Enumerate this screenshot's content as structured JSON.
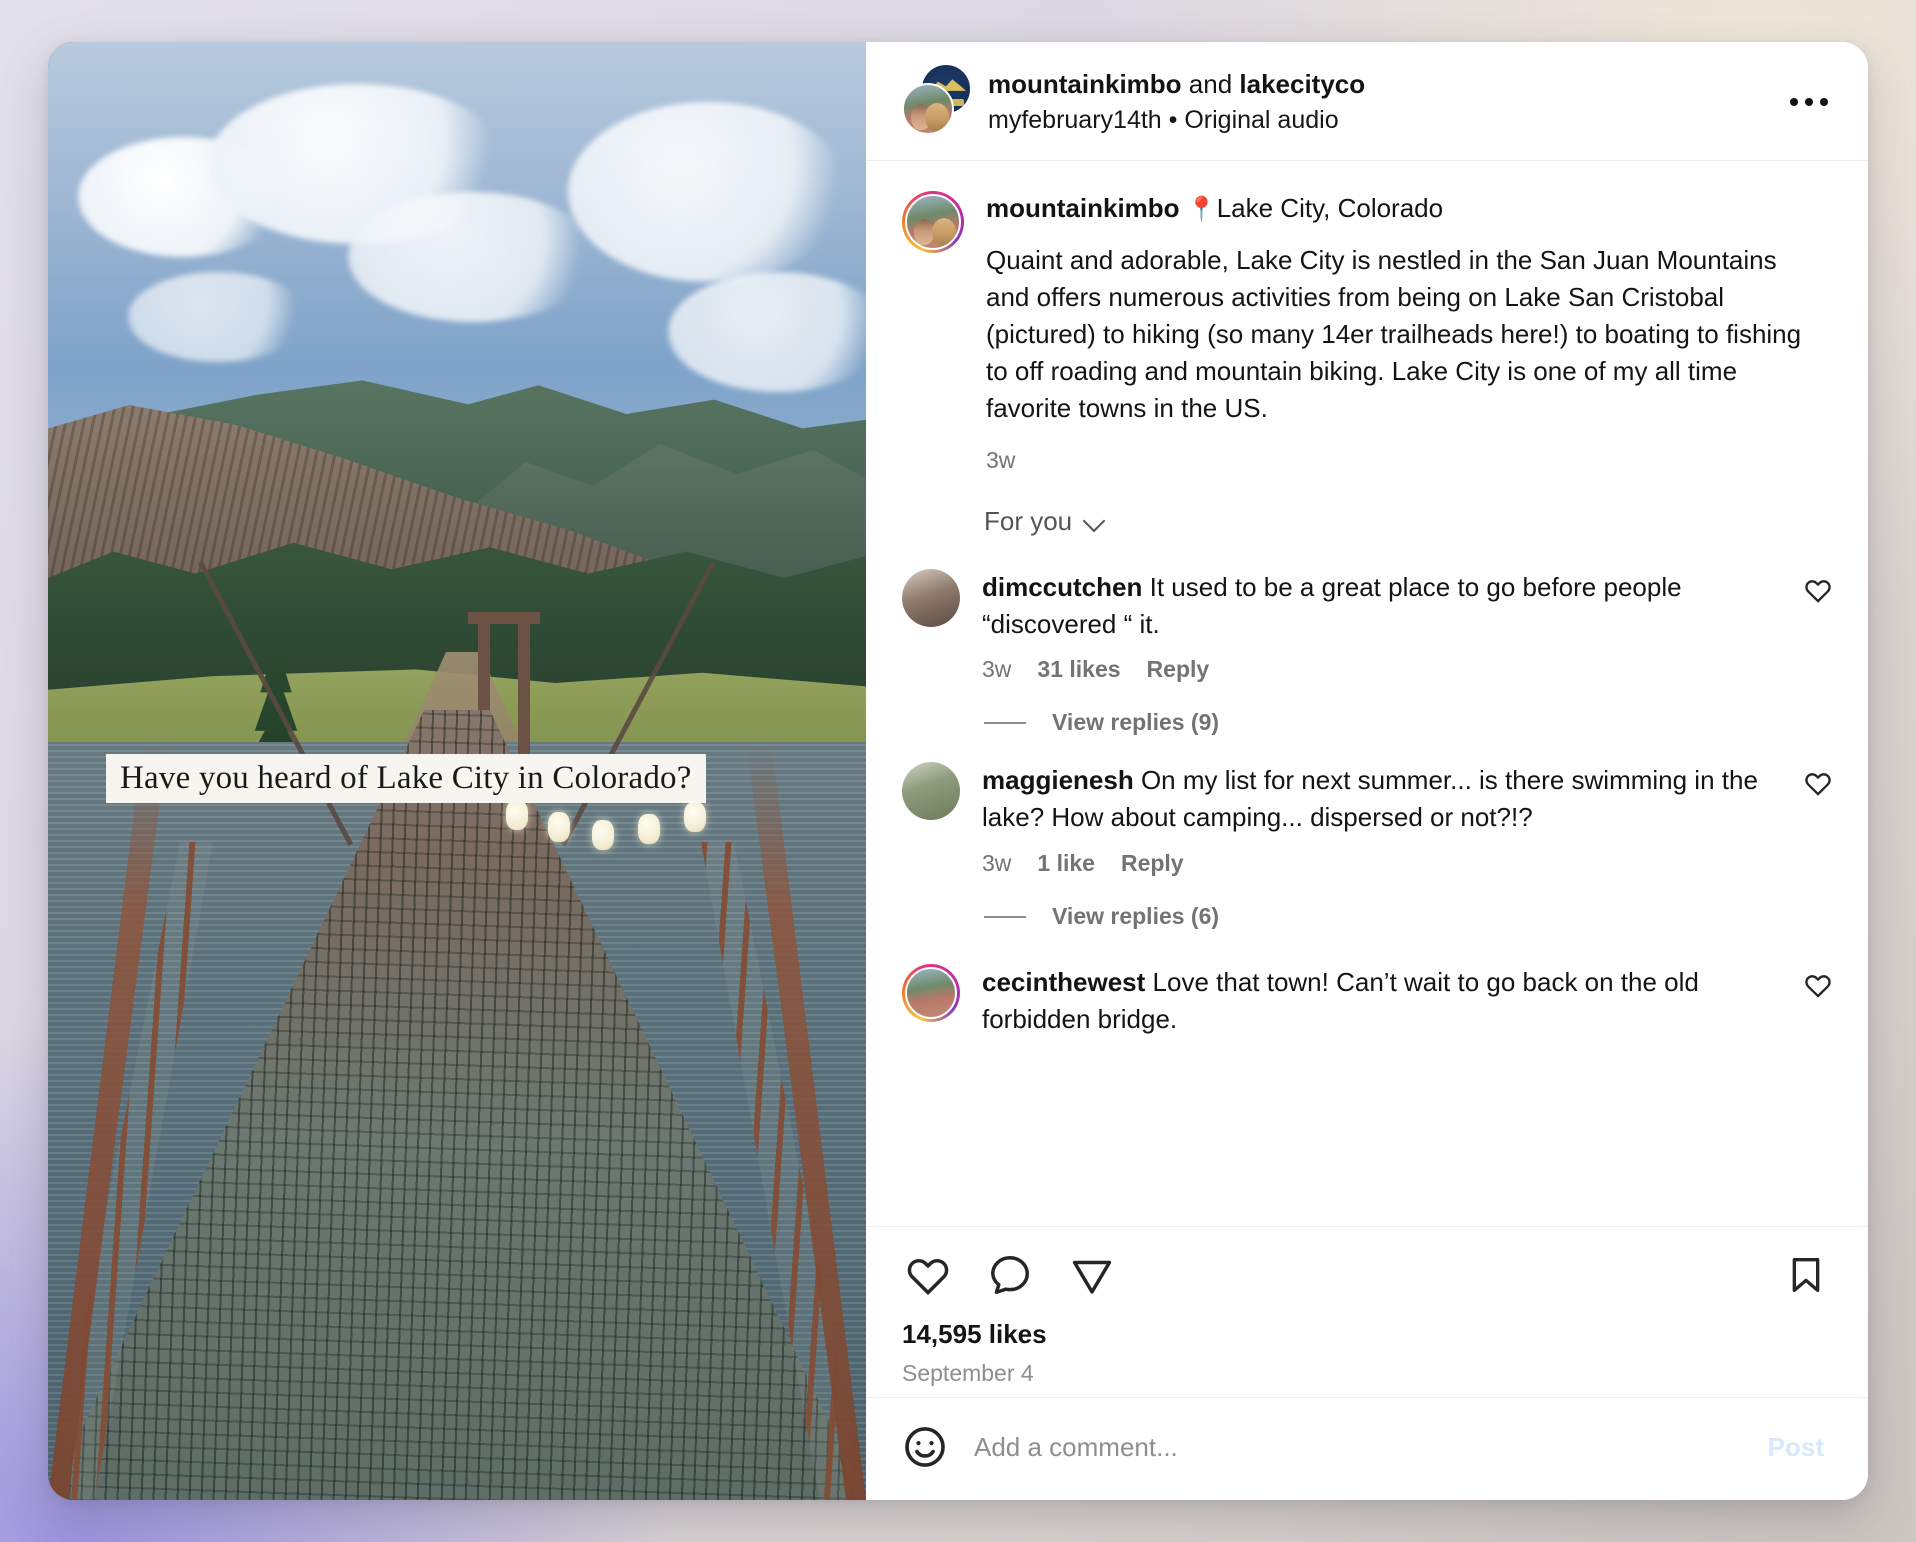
{
  "header": {
    "account_primary": "mountainkimbo",
    "conjunction": " and ",
    "account_secondary": "lakecityco",
    "audio_line": "myfebruary14th • Original audio",
    "more_menu_label": "More options"
  },
  "caption": {
    "username": "mountainkimbo",
    "location_pin": "📍",
    "location": "Lake City, Colorado",
    "text": "Quaint and adorable, Lake City is nestled in the San Juan Mountains and offers numerous activities from being on Lake San Cristobal (pictured) to hiking (so many 14er trailheads here!) to boating to fishing to off roading and mountain biking. Lake City is one of my all time favorite towns in the US.",
    "time": "3w"
  },
  "comments_filter": {
    "label": "For you"
  },
  "comments": [
    {
      "username": "dimccutchen",
      "text": "It used to be a great place to go before people “discovered “ it.",
      "time": "3w",
      "likes": "31 likes",
      "reply": "Reply",
      "view_replies": "View replies (9)"
    },
    {
      "username": "maggienesh",
      "text": "On my list for next summer... is there swimming in the lake? How about camping... dispersed or not?!?",
      "time": "3w",
      "likes": "1 like",
      "reply": "Reply",
      "view_replies": "View replies (6)"
    },
    {
      "username": "cecinthewest",
      "text": "Love that town! Can’t wait to go back on the old forbidden bridge.",
      "time": "",
      "likes": "",
      "reply": "",
      "view_replies": ""
    }
  ],
  "actions": {
    "like_label": "Like",
    "comment_label": "Comment",
    "share_label": "Share",
    "save_label": "Save"
  },
  "stats": {
    "likes": "14,595 likes",
    "date": "September 4"
  },
  "add_comment": {
    "placeholder": "Add a comment...",
    "value": "",
    "post_label": "Post",
    "emoji_icon": "emoji-smiley-icon"
  },
  "media": {
    "overlay_text": "Have you heard of Lake City in Colorado?",
    "alt": "Suspension footbridge over Lake San Cristobal with San Juan Mountains"
  },
  "colors": {
    "accent_post": "#d6e9fb",
    "text_primary": "#141414",
    "text_secondary": "#737373",
    "border": "#efefef"
  }
}
